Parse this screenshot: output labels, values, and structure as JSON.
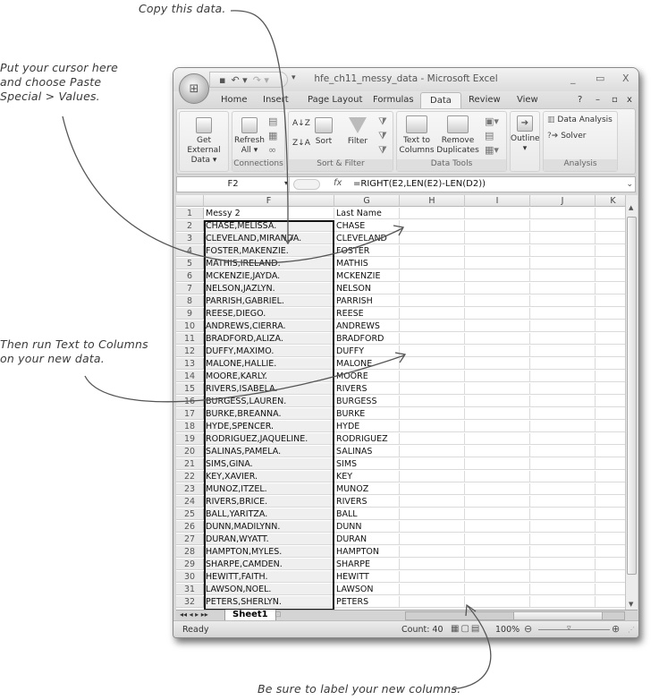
{
  "annotations": {
    "copy": "Copy this data.",
    "paste": [
      "Put your cursor here",
      "and choose Paste",
      "Special > Values."
    ],
    "text_to_columns": [
      "Then run Text to Columns",
      "on your new data."
    ],
    "label": "Be sure to label your new columns."
  },
  "window": {
    "title": "hfe_ch11_messy_data - Microsoft Excel",
    "controls": {
      "minimize": "_",
      "maximize": "▭",
      "close": "X"
    },
    "doc_controls": {
      "help": "?",
      "minimize": "–",
      "restore": "▫",
      "close": "x"
    }
  },
  "tabs": [
    {
      "label": "Home"
    },
    {
      "label": "Insert"
    },
    {
      "label": "Page Layout"
    },
    {
      "label": "Formulas"
    },
    {
      "label": "Data",
      "active": true
    },
    {
      "label": "Review"
    },
    {
      "label": "View"
    }
  ],
  "ribbon": {
    "get_external": {
      "label1": "Get External",
      "label2": "Data ▾"
    },
    "refresh": {
      "label1": "Refresh",
      "label2": "All ▾"
    },
    "connections_label": "Connections",
    "sort_az": "A↓Z",
    "sort_za": "Z↓A",
    "sort": "Sort",
    "filter": "Filter",
    "sort_filter_label": "Sort & Filter",
    "text_to_columns": {
      "label1": "Text to",
      "label2": "Columns"
    },
    "remove_duplicates": {
      "label1": "Remove",
      "label2": "Duplicates"
    },
    "data_tools_label": "Data Tools",
    "outline": {
      "label1": "Outline",
      "label2": "▾"
    },
    "data_analysis": "Data Analysis",
    "solver": "Solver",
    "analysis_label": "Analysis"
  },
  "formula_bar": {
    "name_box": "F2",
    "fx": "fx",
    "formula": "=RIGHT(E2,LEN(E2)-LEN(D2))"
  },
  "sheet": {
    "columns": [
      "F",
      "G",
      "H",
      "I",
      "J",
      "K"
    ],
    "rows": [
      {
        "n": "1",
        "f": "Messy 2",
        "g": "Last Name"
      },
      {
        "n": "2",
        "f": "CHASE,MELISSA.",
        "g": "CHASE"
      },
      {
        "n": "3",
        "f": "CLEVELAND,MIRANDA.",
        "g": "CLEVELAND"
      },
      {
        "n": "4",
        "f": "FOSTER,MAKENZIE.",
        "g": "FOSTER"
      },
      {
        "n": "5",
        "f": "MATHIS,IRELAND.",
        "g": "MATHIS"
      },
      {
        "n": "6",
        "f": "MCKENZIE,JAYDA.",
        "g": "MCKENZIE"
      },
      {
        "n": "7",
        "f": "NELSON,JAZLYN.",
        "g": "NELSON"
      },
      {
        "n": "8",
        "f": "PARRISH,GABRIEL.",
        "g": "PARRISH"
      },
      {
        "n": "9",
        "f": "REESE,DIEGO.",
        "g": "REESE"
      },
      {
        "n": "10",
        "f": "ANDREWS,CIERRA.",
        "g": "ANDREWS"
      },
      {
        "n": "11",
        "f": "BRADFORD,ALIZA.",
        "g": "BRADFORD"
      },
      {
        "n": "12",
        "f": "DUFFY,MAXIMO.",
        "g": "DUFFY"
      },
      {
        "n": "13",
        "f": "MALONE,HALLIE.",
        "g": "MALONE"
      },
      {
        "n": "14",
        "f": "MOORE,KARLY.",
        "g": "MOORE"
      },
      {
        "n": "15",
        "f": "RIVERS,ISABELA.",
        "g": "RIVERS"
      },
      {
        "n": "16",
        "f": "BURGESS,LAUREN.",
        "g": "BURGESS"
      },
      {
        "n": "17",
        "f": "BURKE,BREANNA.",
        "g": "BURKE"
      },
      {
        "n": "18",
        "f": "HYDE,SPENCER.",
        "g": "HYDE"
      },
      {
        "n": "19",
        "f": "RODRIGUEZ,JAQUELINE.",
        "g": "RODRIGUEZ"
      },
      {
        "n": "20",
        "f": "SALINAS,PAMELA.",
        "g": "SALINAS"
      },
      {
        "n": "21",
        "f": "SIMS,GINA.",
        "g": "SIMS"
      },
      {
        "n": "22",
        "f": "KEY,XAVIER.",
        "g": "KEY"
      },
      {
        "n": "23",
        "f": "MUNOZ,ITZEL.",
        "g": "MUNOZ"
      },
      {
        "n": "24",
        "f": "RIVERS,BRICE.",
        "g": "RIVERS"
      },
      {
        "n": "25",
        "f": "BALL,YARITZA.",
        "g": "BALL"
      },
      {
        "n": "26",
        "f": "DUNN,MADILYNN.",
        "g": "DUNN"
      },
      {
        "n": "27",
        "f": "DURAN,WYATT.",
        "g": "DURAN"
      },
      {
        "n": "28",
        "f": "HAMPTON,MYLES.",
        "g": "HAMPTON"
      },
      {
        "n": "29",
        "f": "SHARPE,CAMDEN.",
        "g": "SHARPE"
      },
      {
        "n": "30",
        "f": "HEWITT,FAITH.",
        "g": "HEWITT"
      },
      {
        "n": "31",
        "f": "LAWSON,NOEL.",
        "g": "LAWSON"
      },
      {
        "n": "32",
        "f": "PETERS,SHERLYN.",
        "g": "PETERS"
      }
    ]
  },
  "sheet_tabs": {
    "nav": "◂◂ ◂ ▸ ▸▸",
    "active": "Sheet1"
  },
  "status": {
    "ready": "Ready",
    "count": "Count: 40",
    "zoom": "100%"
  }
}
